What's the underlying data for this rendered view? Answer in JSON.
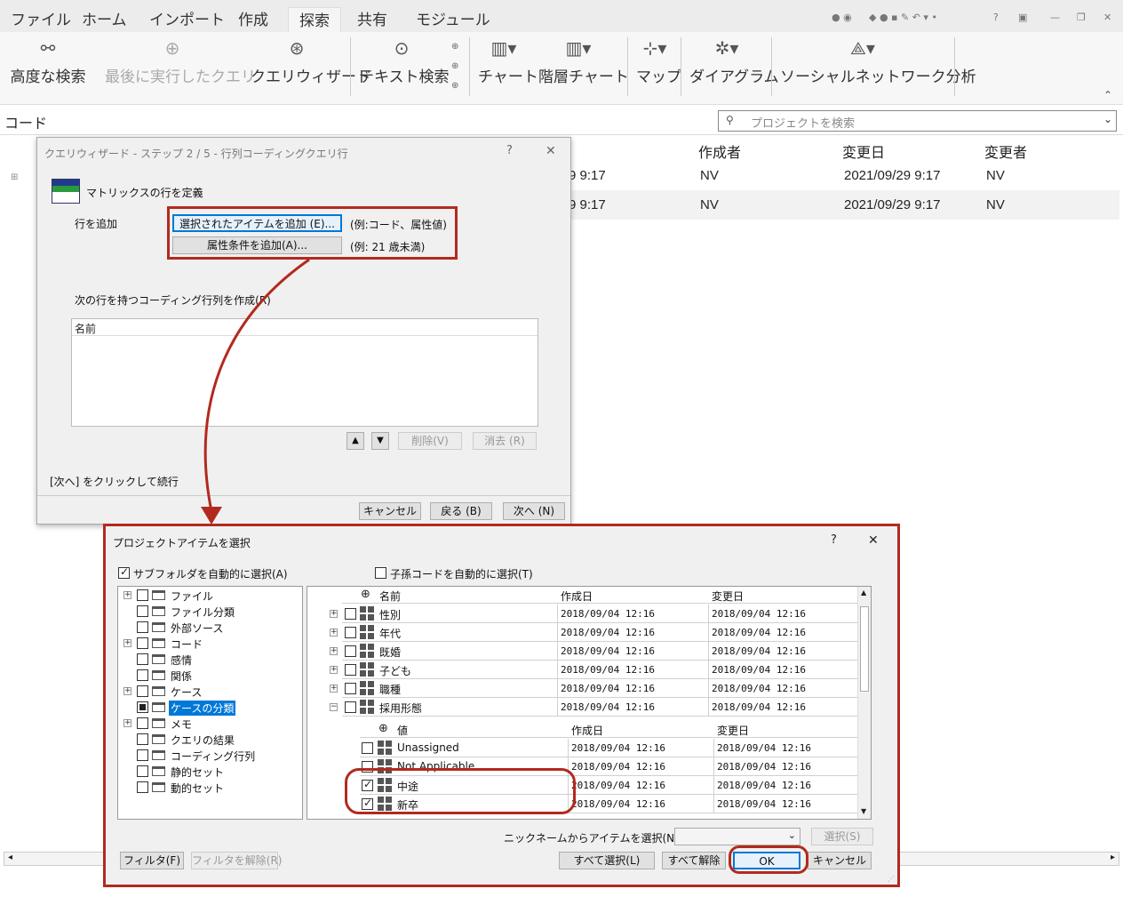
{
  "menu": {
    "tabs": [
      "ファイル",
      "ホーム",
      "インポート",
      "作成",
      "探索",
      "共有",
      "モジュール"
    ],
    "active": "探索"
  },
  "ribbon": {
    "advanced_search": "高度な検索",
    "last_query": "最後に実行したクエリ",
    "query_wizard": "クエリウィザード",
    "text_search": "テキスト検索",
    "chart": "チャート",
    "hier_chart": "階層チャート",
    "map": "マップ",
    "diagram": "ダイアグラム",
    "sna": "ソーシャルネットワーク分析"
  },
  "codebar": {
    "title": "コード",
    "search_placeholder": "プロジェクトを検索"
  },
  "table": {
    "headers": [
      "作成者",
      "変更日",
      "変更者"
    ],
    "rows": [
      {
        "time": "9 9:17",
        "author": "NV",
        "modified": "2021/09/29 9:17",
        "modifier": "NV"
      },
      {
        "time": "9 9:17",
        "author": "NV",
        "modified": "2021/09/29 9:17",
        "modifier": "NV"
      }
    ]
  },
  "wizard": {
    "title": "クエリウィザード - ステップ 2 / 5 - 行列コーディングクエリ行",
    "help": "?",
    "close": "✕",
    "define_rows": "マトリックスの行を定義",
    "add_rows": "行を追加",
    "btn_add_selected": "選択されたアイテムを追加 (E)...",
    "hint_selected": "(例:コード、属性値)",
    "btn_add_attr": "属性条件を追加(A)...",
    "hint_attr": "(例: 21 歳未満)",
    "create_label": "次の行を持つコーディング行列を作成(R)",
    "list_header": "名前",
    "btn_delete": "削除(V)",
    "btn_clear": "消去 (R)",
    "footer_text": "[次へ] をクリックして続行",
    "btn_cancel": "キャンセル",
    "btn_back": "戻る (B)",
    "btn_next": "次へ (N)"
  },
  "picker": {
    "title": "プロジェクトアイテムを選択",
    "help": "?",
    "close": "✕",
    "auto_subfolder": "サブフォルダを自動的に選択(A)",
    "auto_desc": "子孫コードを自動的に選択(T)",
    "tree": [
      "ファイル",
      "ファイル分類",
      "外部ソース",
      "コード",
      "感情",
      "関係",
      "ケース",
      "ケースの分類",
      "メモ",
      "クエリの結果",
      "コーディング行列",
      "静的セット",
      "動的セット"
    ],
    "top_headers": [
      "名前",
      "作成日",
      "変更日"
    ],
    "top_rows": [
      {
        "name": "性別",
        "c": "2018/09/04 12:16",
        "m": "2018/09/04 12:16"
      },
      {
        "name": "年代",
        "c": "2018/09/04 12:16",
        "m": "2018/09/04 12:16"
      },
      {
        "name": "既婚",
        "c": "2018/09/04 12:16",
        "m": "2018/09/04 12:16"
      },
      {
        "name": "子ども",
        "c": "2018/09/04 12:16",
        "m": "2018/09/04 12:16"
      },
      {
        "name": "職種",
        "c": "2018/09/04 12:16",
        "m": "2018/09/04 12:16"
      },
      {
        "name": "採用形態",
        "c": "2018/09/04 12:16",
        "m": "2018/09/04 12:16"
      }
    ],
    "sub_headers": [
      "値",
      "作成日",
      "変更日"
    ],
    "sub_rows": [
      {
        "name": "Unassigned",
        "c": "2018/09/04 12:16",
        "m": "2018/09/04 12:16"
      },
      {
        "name": "Not Applicable",
        "c": "2018/09/04 12:16",
        "m": "2018/09/04 12:16"
      },
      {
        "name": "中途",
        "c": "2018/09/04 12:16",
        "m": "2018/09/04 12:16"
      },
      {
        "name": "新卒",
        "c": "2018/09/04 12:16",
        "m": "2018/09/04 12:16"
      }
    ],
    "nickname_label": "ニックネームからアイテムを選択(N)",
    "btn_select": "選択(S)",
    "btn_filter": "フィルタ(F)",
    "btn_unfilter": "フィルタを解除(R)",
    "btn_select_all": "すべて選択(L)",
    "btn_deselect_all": "すべて解除",
    "btn_ok": "OK",
    "btn_cancel": "キャンセル"
  },
  "colors": {
    "annotation_red": "#b22a1e",
    "focus_blue": "#0078d7",
    "selection": "#0078d7"
  }
}
